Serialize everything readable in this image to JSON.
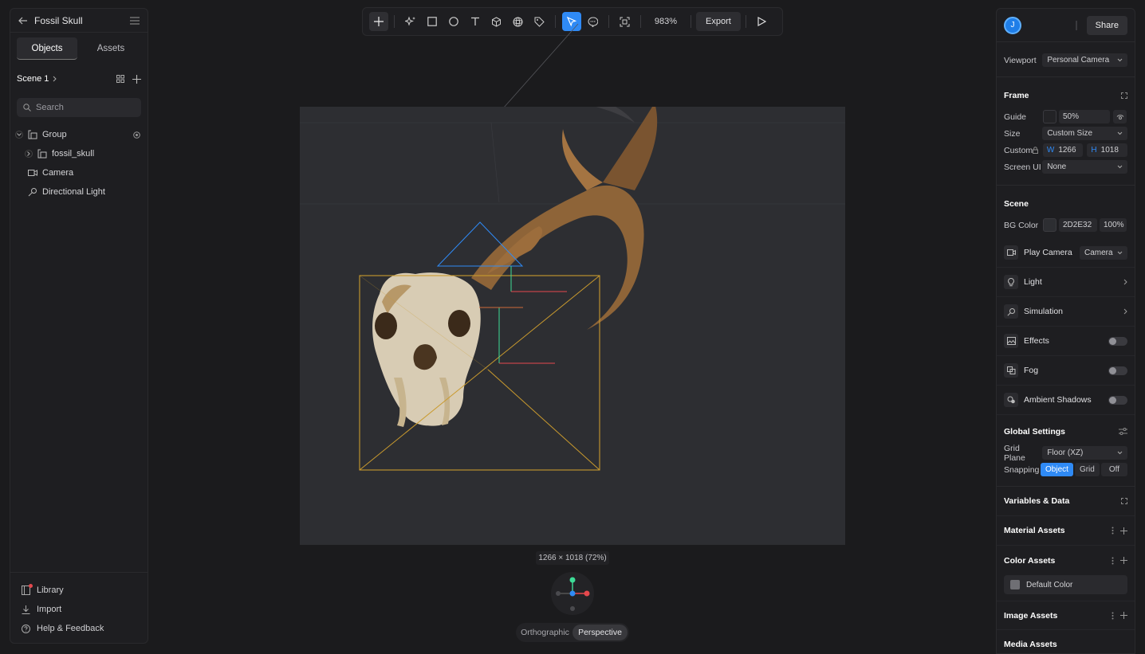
{
  "project": {
    "title": "Fossil Skull"
  },
  "left_tabs": [
    "Objects",
    "Assets"
  ],
  "scene": {
    "name": "Scene 1"
  },
  "search": {
    "placeholder": "Search"
  },
  "tree": [
    {
      "label": "Group",
      "icon": "group-icon"
    },
    {
      "label": "fossil_skull",
      "icon": "group-icon"
    },
    {
      "label": "Camera",
      "icon": "camera-icon"
    },
    {
      "label": "Directional Light",
      "icon": "light-icon"
    }
  ],
  "footer": {
    "library": "Library",
    "import": "Import",
    "help": "Help & Feedback"
  },
  "toolbar": {
    "zoom": "983%",
    "export": "Export"
  },
  "canvas": {
    "size_label": "1266 × 1018 (72%)",
    "orthographic": "Orthographic",
    "perspective": "Perspective"
  },
  "right": {
    "avatar_initial": "J",
    "share": "Share",
    "viewport_label": "Viewport",
    "viewport_value": "Personal Camera",
    "frame_title": "Frame",
    "guide_label": "Guide",
    "guide_value": "50%",
    "size_label": "Size",
    "size_value": "Custom Size",
    "custom_label": "Custom",
    "w_label": "W",
    "w_value": "1266",
    "h_label": "H",
    "h_value": "1018",
    "screen_ui_label": "Screen UI",
    "screen_ui_value": "None",
    "scene_title": "Scene",
    "bg_color_label": "BG Color",
    "bg_color_hex": "2D2E32",
    "bg_opacity": "100%",
    "play_camera_label": "Play Camera",
    "play_camera_value": "Camera",
    "light": "Light",
    "simulation": "Simulation",
    "effects": "Effects",
    "fog": "Fog",
    "ambient_shadows": "Ambient Shadows",
    "global_settings": "Global Settings",
    "grid_plane_label": "Grid Plane",
    "grid_plane_value": "Floor (XZ)",
    "snapping_label": "Snapping",
    "snapping_options": [
      "Object",
      "Grid",
      "Off"
    ],
    "variables_data": "Variables & Data",
    "material_assets": "Material Assets",
    "color_assets": "Color Assets",
    "default_color": "Default Color",
    "image_assets": "Image Assets",
    "media_assets": "Media Assets"
  },
  "colors": {
    "accent": "#2f8af5",
    "canvas_bg": "#2d2e32",
    "frame_outline": "#c99a2e",
    "axis_x": "#e5484d",
    "axis_y": "#3ddc97",
    "axis_z": "#2f8af5"
  }
}
